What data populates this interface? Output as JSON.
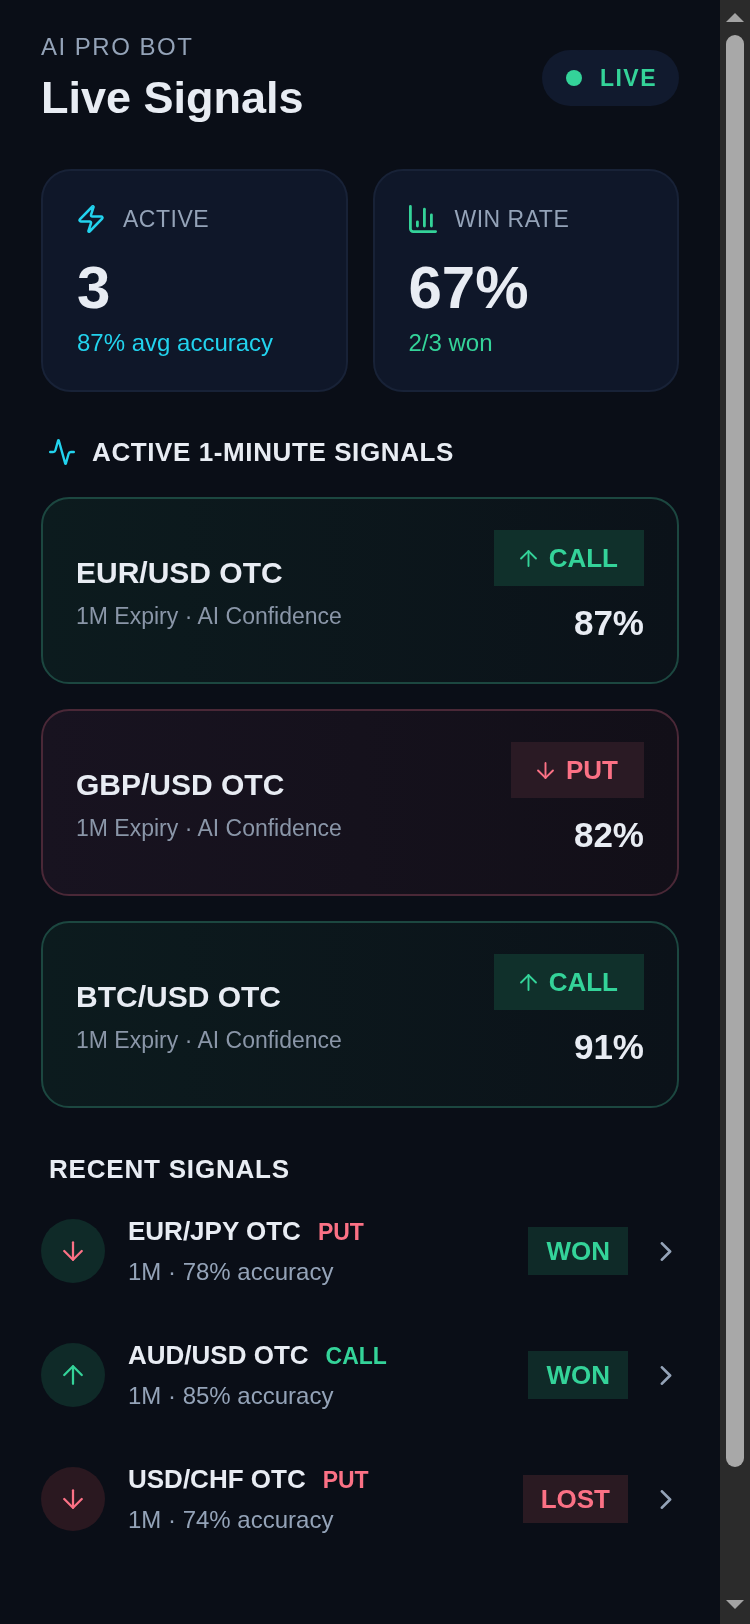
{
  "header": {
    "eyebrow": "AI PRO BOT",
    "title": "Live Signals",
    "status": {
      "label": "LIVE"
    }
  },
  "stats": [
    {
      "kind": "active",
      "label": "ACTIVE",
      "value": "3",
      "detail": "87% avg accuracy"
    },
    {
      "kind": "win_rate",
      "label": "WIN RATE",
      "value": "67%",
      "detail": "2/3 won"
    }
  ],
  "active_signals": {
    "title": "ACTIVE 1-MINUTE SIGNALS",
    "items": [
      {
        "pair": "EUR/USD OTC",
        "meta": "1M Expiry · AI Confidence",
        "kind": "call",
        "action": "CALL",
        "confidence": "87%"
      },
      {
        "pair": "GBP/USD OTC",
        "meta": "1M Expiry · AI Confidence",
        "kind": "put",
        "action": "PUT",
        "confidence": "82%"
      },
      {
        "pair": "BTC/USD OTC",
        "meta": "1M Expiry · AI Confidence",
        "kind": "call",
        "action": "CALL",
        "confidence": "91%"
      }
    ]
  },
  "recent_signals": {
    "title": "RECENT SIGNALS",
    "items": [
      {
        "pair": "EUR/JPY OTC",
        "kind": "put",
        "action": "PUT",
        "meta": "1M · 78% accuracy",
        "won": true,
        "result": "WON"
      },
      {
        "pair": "AUD/USD OTC",
        "kind": "call",
        "action": "CALL",
        "meta": "1M · 85% accuracy",
        "won": true,
        "result": "WON"
      },
      {
        "pair": "USD/CHF OTC",
        "kind": "put",
        "action": "PUT",
        "meta": "1M · 74% accuracy",
        "won": false,
        "result": "LOST"
      }
    ]
  }
}
